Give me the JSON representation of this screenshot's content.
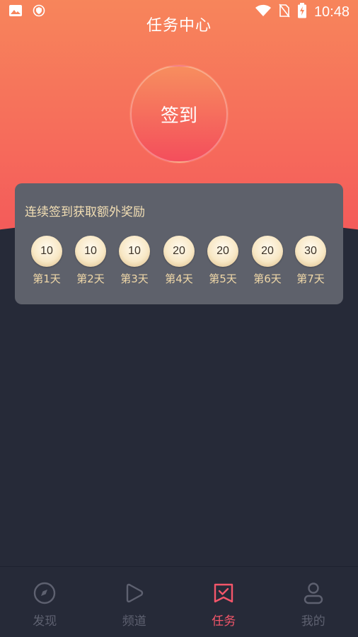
{
  "status_bar": {
    "time": "10:48"
  },
  "header": {
    "title": "任务中心"
  },
  "checkin": {
    "button_label": "签到"
  },
  "reward_card": {
    "title": "连续签到获取额外奖励",
    "days": [
      {
        "points": "10",
        "label": "第1天"
      },
      {
        "points": "10",
        "label": "第2天"
      },
      {
        "points": "10",
        "label": "第3天"
      },
      {
        "points": "20",
        "label": "第4天"
      },
      {
        "points": "20",
        "label": "第5天"
      },
      {
        "points": "20",
        "label": "第6天"
      },
      {
        "points": "30",
        "label": "第7天"
      }
    ]
  },
  "tabbar": {
    "items": [
      {
        "label": "发现",
        "icon": "compass-icon",
        "active": false
      },
      {
        "label": "频道",
        "icon": "play-icon",
        "active": false
      },
      {
        "label": "任务",
        "icon": "task-check-icon",
        "active": true
      },
      {
        "label": "我的",
        "icon": "user-icon",
        "active": false
      }
    ],
    "active_color": "#f4566a",
    "inactive_color": "#5e6170"
  }
}
